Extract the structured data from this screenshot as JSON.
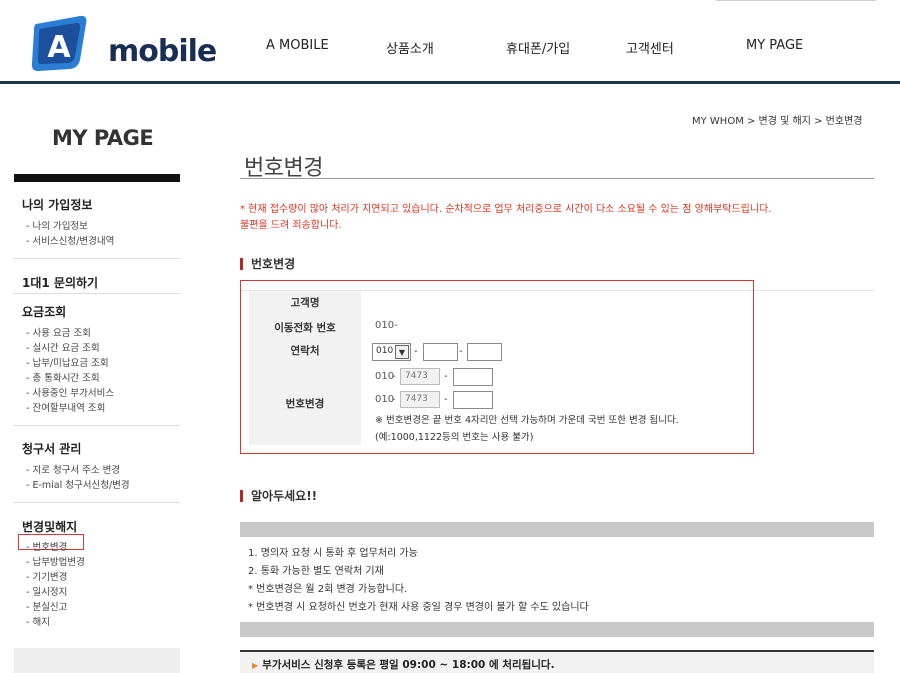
{
  "header": {
    "logo_letter": "A",
    "logo_text": "mobile",
    "nav": [
      "A MOBILE",
      "상품소개",
      "휴대폰/가입",
      "고객센터",
      "MY PAGE"
    ]
  },
  "sidebar": {
    "title": "MY PAGE",
    "groups": [
      {
        "title": "나의 가입정보",
        "items": [
          "- 나의 가입정보",
          "- 서비스신청/변경내역"
        ]
      },
      {
        "title": "1대1 문의하기",
        "items": []
      },
      {
        "title": "요금조회",
        "items": [
          "- 사용 요금 조회",
          "- 실시간 요금 조회",
          "- 납부/미납요금 조회",
          "- 총 통화시간 조회",
          "- 사용중인 부가서비스",
          "- 잔여할부내역 조회"
        ]
      },
      {
        "title": "청구서 관리",
        "items": [
          "- 지로 청구서 주소 변경",
          "- E-mial 청구서신청/변경"
        ]
      },
      {
        "title": "변경및해지",
        "items": [
          "- 번호변경",
          "- 납부방법변경",
          "- 기기변경",
          "- 일시정지",
          "- 분실신고",
          "- 해지"
        ]
      }
    ],
    "selected_item": "- 번호변경"
  },
  "breadcrumb": "MY WHOM > 변경 및 해지 > 번호변경",
  "page_title": "번호변경",
  "notice": {
    "line1": "* 현재 접수량이 많아 처리가 지연되고 있습니다. 순차적으로 업무 처리중으로 시간이 다소 소요될 수 있는 점 양해부탁드립니다.",
    "line2": "불편을 드려 죄송합니다."
  },
  "section1": "번호변경",
  "form": {
    "labels": {
      "name": "고객명",
      "mobile": "이동전화 번호",
      "contact": "연락처",
      "change": "번호변경"
    },
    "name_value": "",
    "mobile_value": "010-",
    "contact_prefix": "010",
    "change_prefix": "010",
    "change_middle": "7473",
    "dash": "-",
    "hint1": "※ 번호변경은 끝 번호 4자리만 선택 가능하며 가운데 국번 또한 변경 됩니다.",
    "hint2": "(예:1000,1122등의 번호는 사용 불가)"
  },
  "section2": "알아두세요!!",
  "info": [
    "1. 명의자 요청 시 통화 후 업무처리 가능",
    "2. 통화 가능한 별도 연락처 기재",
    "* 번호변경은 월 2회 변경 가능합니다.",
    "* 번호변경 시 요청하신 번호가 현재 사용 중일 경우 변경이 불가 할 수도 있습니다"
  ],
  "bottom_notice": "부가서비스 신청후 등록은 평일 09:00 ~ 18:00 에 처리됩니다.",
  "colors": {
    "accent": "#d23a3a",
    "navy": "#1f3552",
    "logo_blue": "#2a7fd4"
  }
}
